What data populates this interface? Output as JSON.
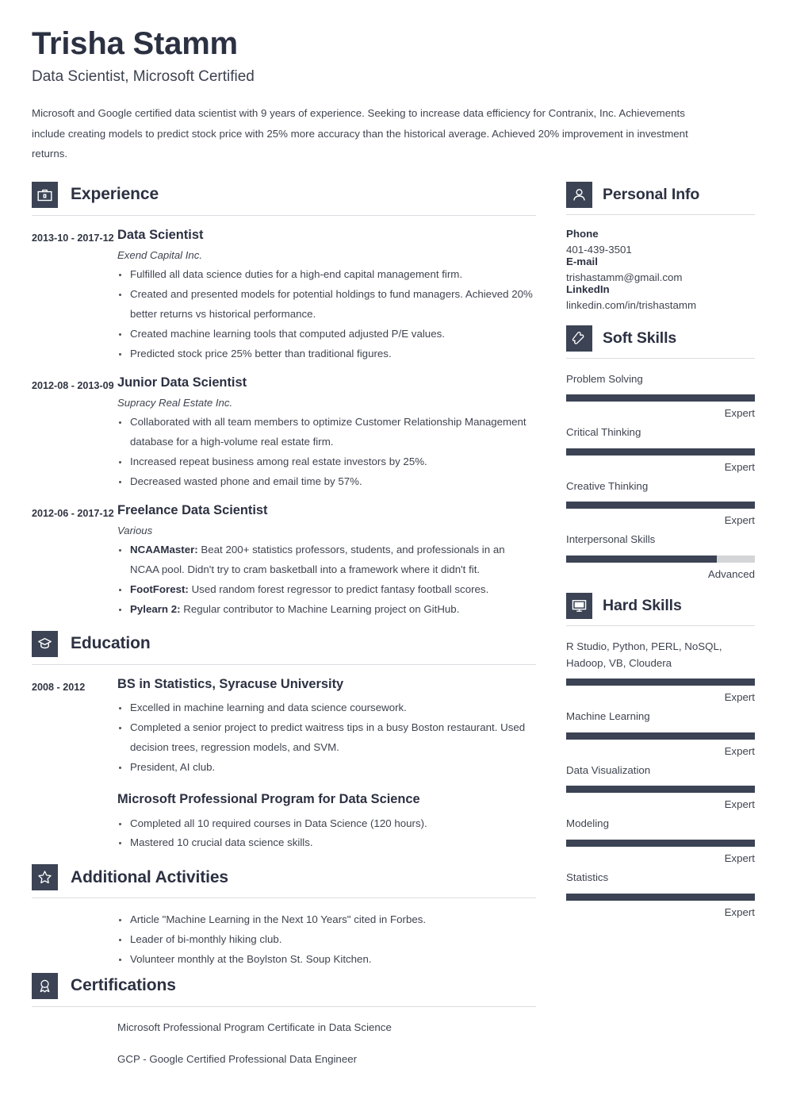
{
  "header": {
    "name": "Trisha Stamm",
    "job_title": "Data Scientist, Microsoft Certified",
    "summary": "Microsoft and Google certified data scientist with 9 years of experience. Seeking to increase data efficiency for Contranix, Inc. Achievements include creating models to predict stock price with 25% more accuracy than the historical average. Achieved 20% improvement in investment returns."
  },
  "sections": {
    "experience": {
      "title": "Experience",
      "icon": "briefcase-icon",
      "entries": [
        {
          "dates": "2013-10 - 2017-12",
          "role": "Data Scientist",
          "org": "Exend Capital Inc.",
          "bullets": [
            "Fulfilled all data science duties for a high-end capital management firm.",
            "Created and presented models for potential holdings to fund managers. Achieved 20% better returns vs historical performance.",
            "Created machine learning tools that computed adjusted P/E values.",
            "Predicted stock price 25% better than traditional figures."
          ]
        },
        {
          "dates": "2012-08 - 2013-09",
          "role": "Junior Data Scientist",
          "org": "Supracy Real Estate Inc.",
          "bullets": [
            "Collaborated with all team members to optimize Customer Relationship Management database for a high-volume real estate firm.",
            "Increased repeat business among real estate investors by 25%.",
            "Decreased wasted phone and email time by 57%."
          ]
        },
        {
          "dates": "2012-06 - 2017-12",
          "role": "Freelance Data Scientist",
          "org": "Various",
          "bullets_rich": [
            {
              "lead": "NCAAMaster:",
              "text": " Beat 200+ statistics professors, students, and professionals in an NCAA pool. Didn't try to cram basketball into a framework where it didn't fit."
            },
            {
              "lead": "FootForest:",
              "text": " Used random forest regressor to predict fantasy football scores."
            },
            {
              "lead": "Pylearn 2:",
              "text": " Regular contributor to Machine Learning project on GitHub."
            }
          ]
        }
      ]
    },
    "education": {
      "title": "Education",
      "icon": "graduation-cap-icon",
      "entries": [
        {
          "dates": "2008 - 2012",
          "degree": "BS in Statistics, Syracuse University",
          "bullets": [
            "Excelled in machine learning and data science coursework.",
            "Completed a senior project to predict waitress tips in a busy Boston restaurant. Used decision trees, regression models, and SVM.",
            "President, AI club."
          ]
        },
        {
          "degree": "Microsoft Professional Program for Data Science",
          "bullets": [
            "Completed all 10 required courses in Data Science (120 hours).",
            "Mastered 10 crucial data science skills."
          ]
        }
      ]
    },
    "additional_activities": {
      "title": "Additional Activities",
      "icon": "star-icon",
      "bullets": [
        "Article \"Machine Learning in the Next 10 Years\" cited in Forbes.",
        "Leader of bi-monthly hiking club.",
        "Volunteer monthly at the Boylston St. Soup Kitchen."
      ]
    },
    "certifications": {
      "title": "Certifications",
      "icon": "award-ribbon-icon",
      "items": [
        "Microsoft Professional Program Certificate in Data Science",
        "GCP - Google Certified Professional Data Engineer"
      ]
    },
    "personal_info": {
      "title": "Personal Info",
      "icon": "person-icon",
      "fields": [
        {
          "label": "Phone",
          "value": "401-439-3501"
        },
        {
          "label": "E-mail",
          "value": "trishastamm@gmail.com"
        },
        {
          "label": "LinkedIn",
          "value": "linkedin.com/in/trishastamm"
        }
      ]
    },
    "soft_skills": {
      "title": "Soft Skills",
      "icon": "puzzle-piece-icon",
      "skills": [
        {
          "name": "Problem Solving",
          "level": "Expert",
          "percent": 100
        },
        {
          "name": "Critical Thinking",
          "level": "Expert",
          "percent": 100
        },
        {
          "name": "Creative Thinking",
          "level": "Expert",
          "percent": 100
        },
        {
          "name": "Interpersonal Skills",
          "level": "Advanced",
          "percent": 80
        }
      ]
    },
    "hard_skills": {
      "title": "Hard Skills",
      "icon": "monitor-icon",
      "skills": [
        {
          "name": "R Studio, Python, PERL, NoSQL, Hadoop, VB, Cloudera",
          "level": "Expert",
          "percent": 100
        },
        {
          "name": "Machine Learning",
          "level": "Expert",
          "percent": 100
        },
        {
          "name": "Data Visualization",
          "level": "Expert",
          "percent": 100
        },
        {
          "name": "Modeling",
          "level": "Expert",
          "percent": 100
        },
        {
          "name": "Statistics",
          "level": "Expert",
          "percent": 100
        }
      ]
    }
  },
  "colors": {
    "accent_dark": "#3b4354",
    "heading": "#2c3142",
    "body_text": "#3f4450",
    "divider": "#dcdde1",
    "bar_track": "#d4d5d6",
    "background": "#ffffff"
  }
}
